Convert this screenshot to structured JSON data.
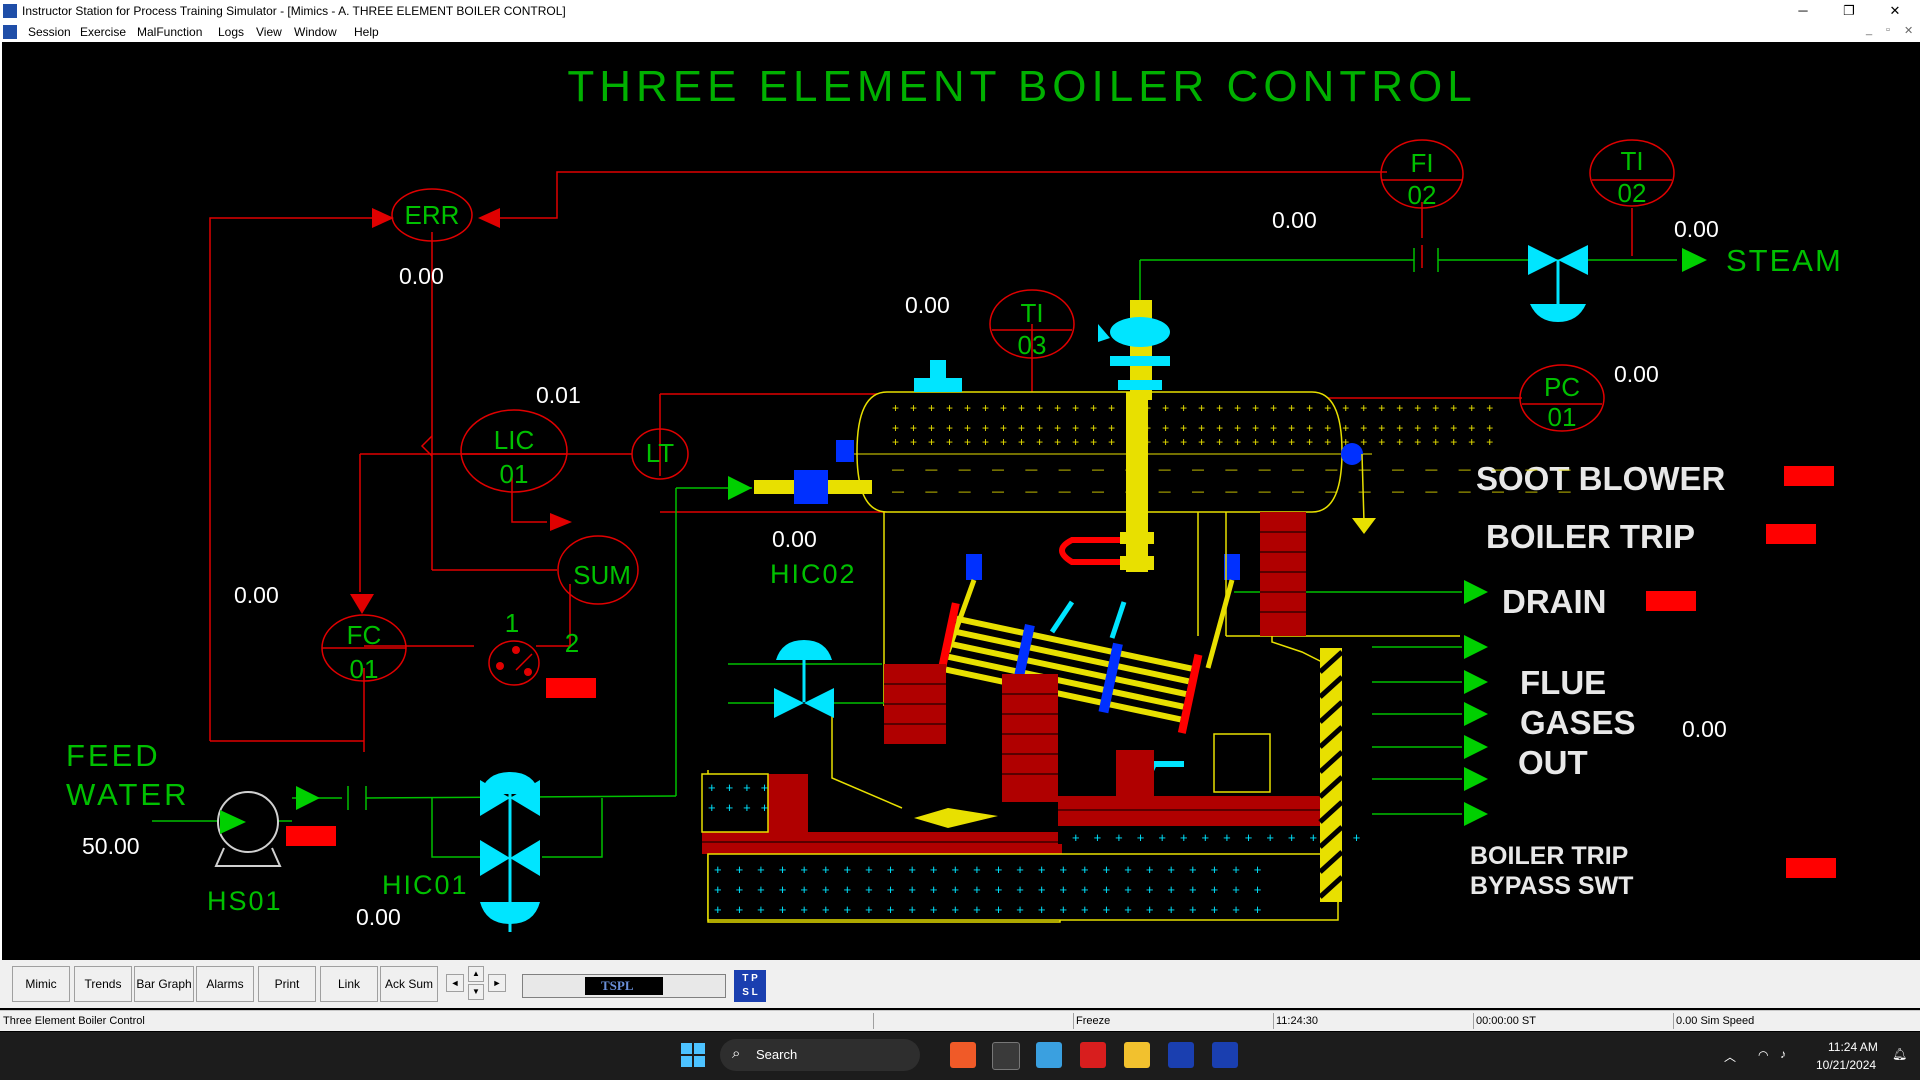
{
  "window": {
    "title": "Instructor Station for Process Training Simulator - [Mimics - A. THREE ELEMENT BOILER CONTROL]",
    "minimize": "─",
    "maximize": "❐",
    "close": "✕"
  },
  "menu": [
    "Session",
    "Exercise",
    "MalFunction",
    "Logs",
    "View",
    "Window",
    "Help"
  ],
  "mimic": {
    "title": "THREE ELEMENT BOILER CONTROL",
    "instruments": {
      "err": "ERR",
      "fi02_a": "FI",
      "fi02_b": "02",
      "ti02_a": "TI",
      "ti02_b": "02",
      "ti03_a": "TI",
      "ti03_b": "03",
      "pc01_a": "PC",
      "pc01_b": "01",
      "lic01_a": "LIC",
      "lic01_b": "01",
      "lt": "LT",
      "sum": "SUM",
      "fc01_a": "FC",
      "fc01_b": "01"
    },
    "values": {
      "err": "0.00",
      "fi02": "0.00",
      "steam": "0.00",
      "ti03": "0.00",
      "pc01": "0.00",
      "lt": "0.01",
      "fc01": "0.00",
      "hic02": "0.00",
      "feed": "50.00",
      "hic01": "0.00",
      "flue": "0.00"
    },
    "labels": {
      "steam": "STEAM",
      "soot_blower": "SOOT BLOWER",
      "boiler_trip": "BOILER TRIP",
      "drain": "DRAIN",
      "flue1": "FLUE",
      "flue2": "GASES",
      "flue3": "OUT",
      "bypass1": "BOILER TRIP",
      "bypass2": "BYPASS SWT",
      "feed1": "FEED",
      "feed2": "WATER",
      "hs01": "HS01",
      "hic01": "HIC01",
      "hic02": "HIC02",
      "sel1": "1",
      "sel2": "2"
    }
  },
  "toolbar": {
    "buttons": [
      "Mimic",
      "Trends",
      "Bar Graph",
      "Alarms",
      "Print",
      "Link",
      "Ack Sum"
    ],
    "logo": "TSPL"
  },
  "status": {
    "name": "Three Element Boiler Control",
    "mode": "Freeze",
    "clock": "11:24:30",
    "sim_time": "00:00:00 ST",
    "speed": "0.00 Sim Speed"
  },
  "taskbar": {
    "search": "Search",
    "time": "11:24 AM",
    "date": "10/21/2024"
  }
}
